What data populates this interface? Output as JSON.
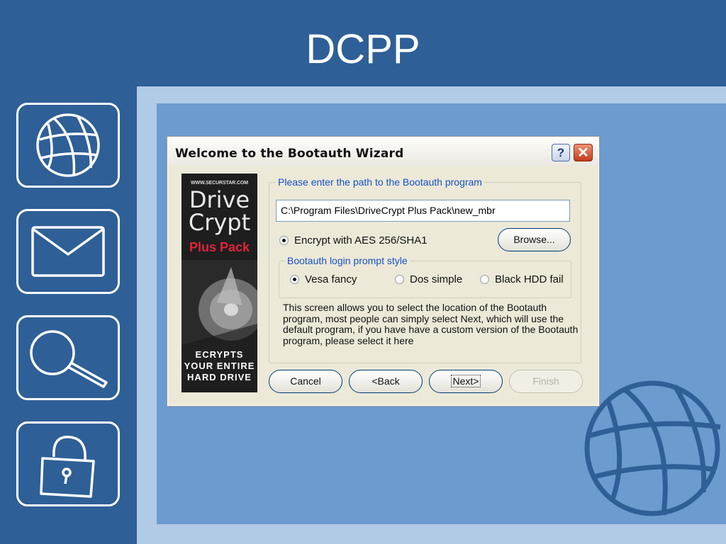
{
  "slide": {
    "title": "DCPP",
    "side_icons": [
      "globe-icon",
      "envelope-icon",
      "magnifier-icon",
      "padlock-icon"
    ],
    "colors": {
      "background": "#2e5f96",
      "frame": "#b1cae6",
      "panel": "#6c9bd0",
      "globe": "#2e5f96"
    }
  },
  "dialog": {
    "title": "Welcome to the Bootauth Wizard",
    "help_label": "?",
    "close_label": "✕",
    "banner": {
      "url": "WWW.SECURSTAR.COM",
      "line1": "Drive",
      "line2": "Crypt",
      "line3": "Plus Pack",
      "tag1": "ECRYPTS",
      "tag2": "YOUR ENTIRE",
      "tag3": "HARD DRIVE"
    },
    "path_group": {
      "label": "Please enter the path to the Bootauth program",
      "path_value": "C:\\Program Files\\DriveCrypt Plus Pack\\new_mbr",
      "encrypt_label": "Encrypt with AES 256/SHA1",
      "browse_label": "Browse..."
    },
    "style_group": {
      "label": "Bootauth login prompt style",
      "options": [
        "Vesa fancy",
        "Dos simple",
        "Black HDD fail"
      ],
      "selected": "Vesa fancy"
    },
    "description": "This screen allows you to select the location of the Bootauth program, most people can simply select Next, which will use the default program, if you have have a custom version of the Bootauth program, please select it here",
    "buttons": {
      "cancel": "Cancel",
      "back": "<Back",
      "next": "Next>",
      "finish": "Finish"
    }
  }
}
